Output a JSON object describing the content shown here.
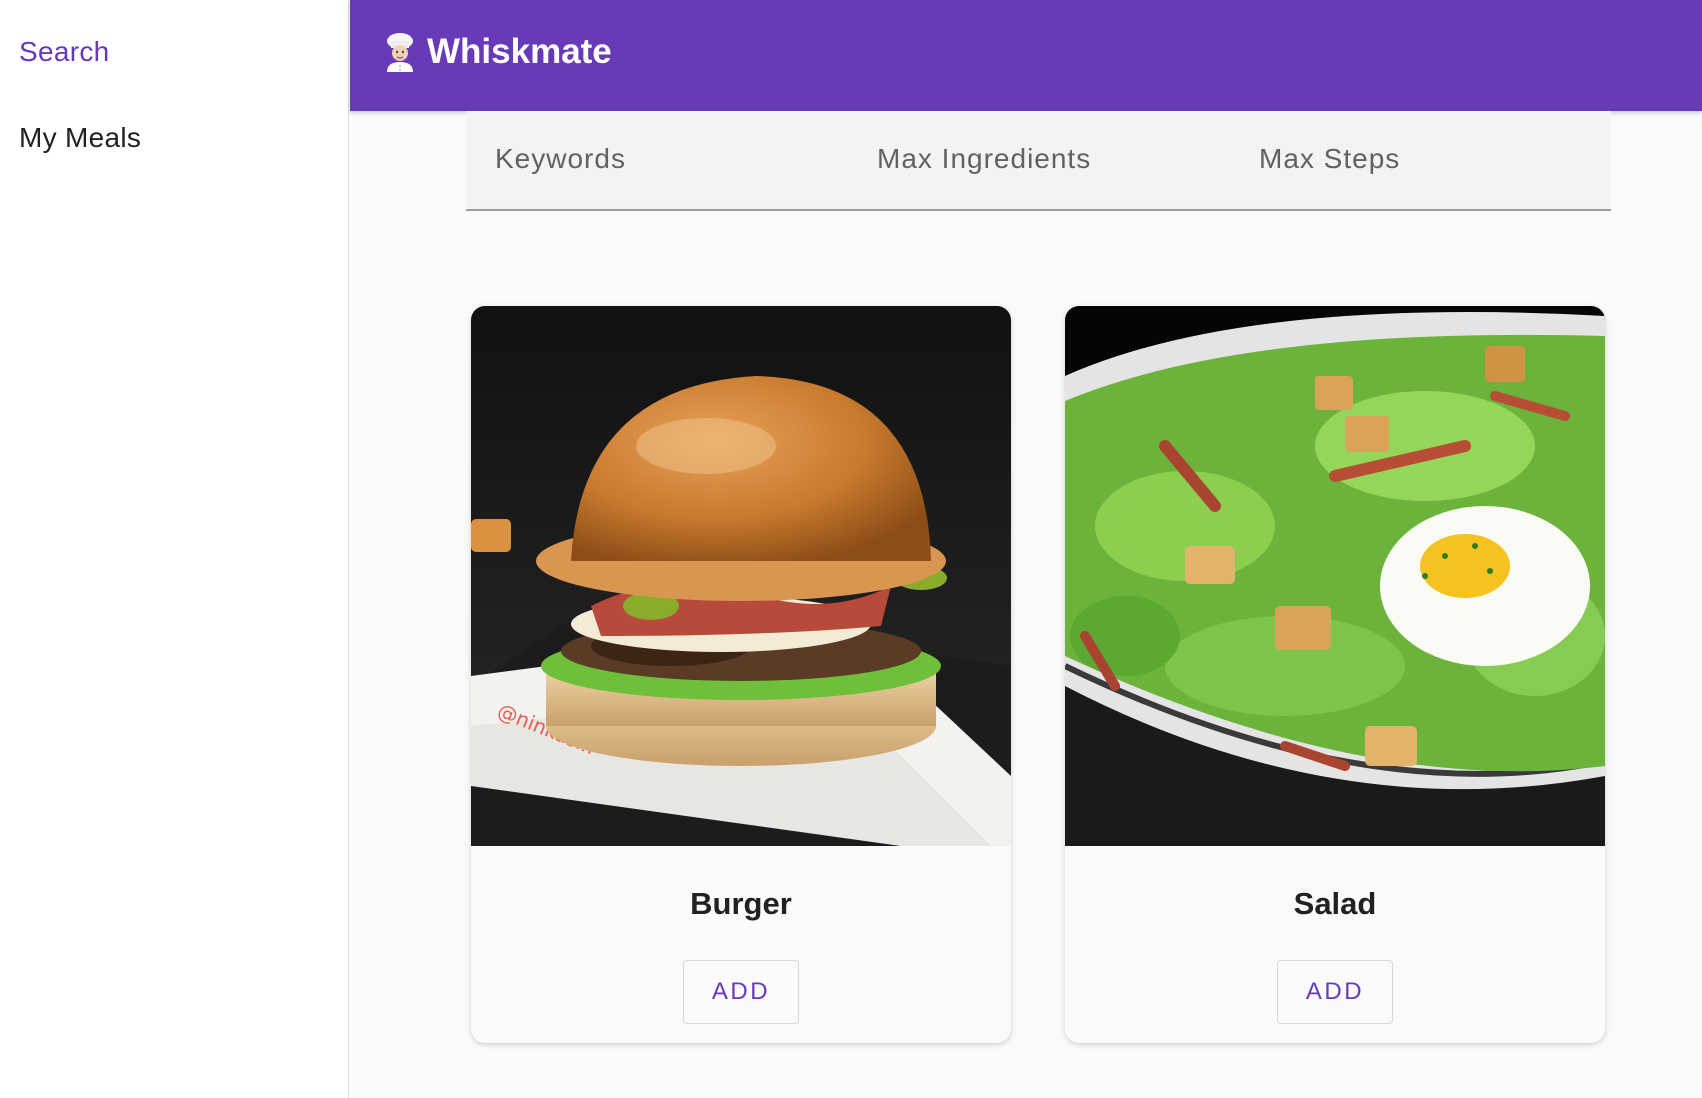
{
  "sidebar": {
    "items": [
      {
        "label": "Search",
        "active": true
      },
      {
        "label": "My Meals",
        "active": false
      }
    ]
  },
  "appbar": {
    "icon": "chef-emoji-icon",
    "title": "Whiskmate",
    "color": "#673ab7"
  },
  "filters": {
    "keywords_placeholder": "Keywords",
    "max_ingredients_placeholder": "Max Ingredients",
    "max_steps_placeholder": "Max Steps"
  },
  "meals": [
    {
      "name": "Burger",
      "button_label": "ADD",
      "watermark": "@ninkasifr"
    },
    {
      "name": "Salad",
      "button_label": "ADD"
    }
  ]
}
